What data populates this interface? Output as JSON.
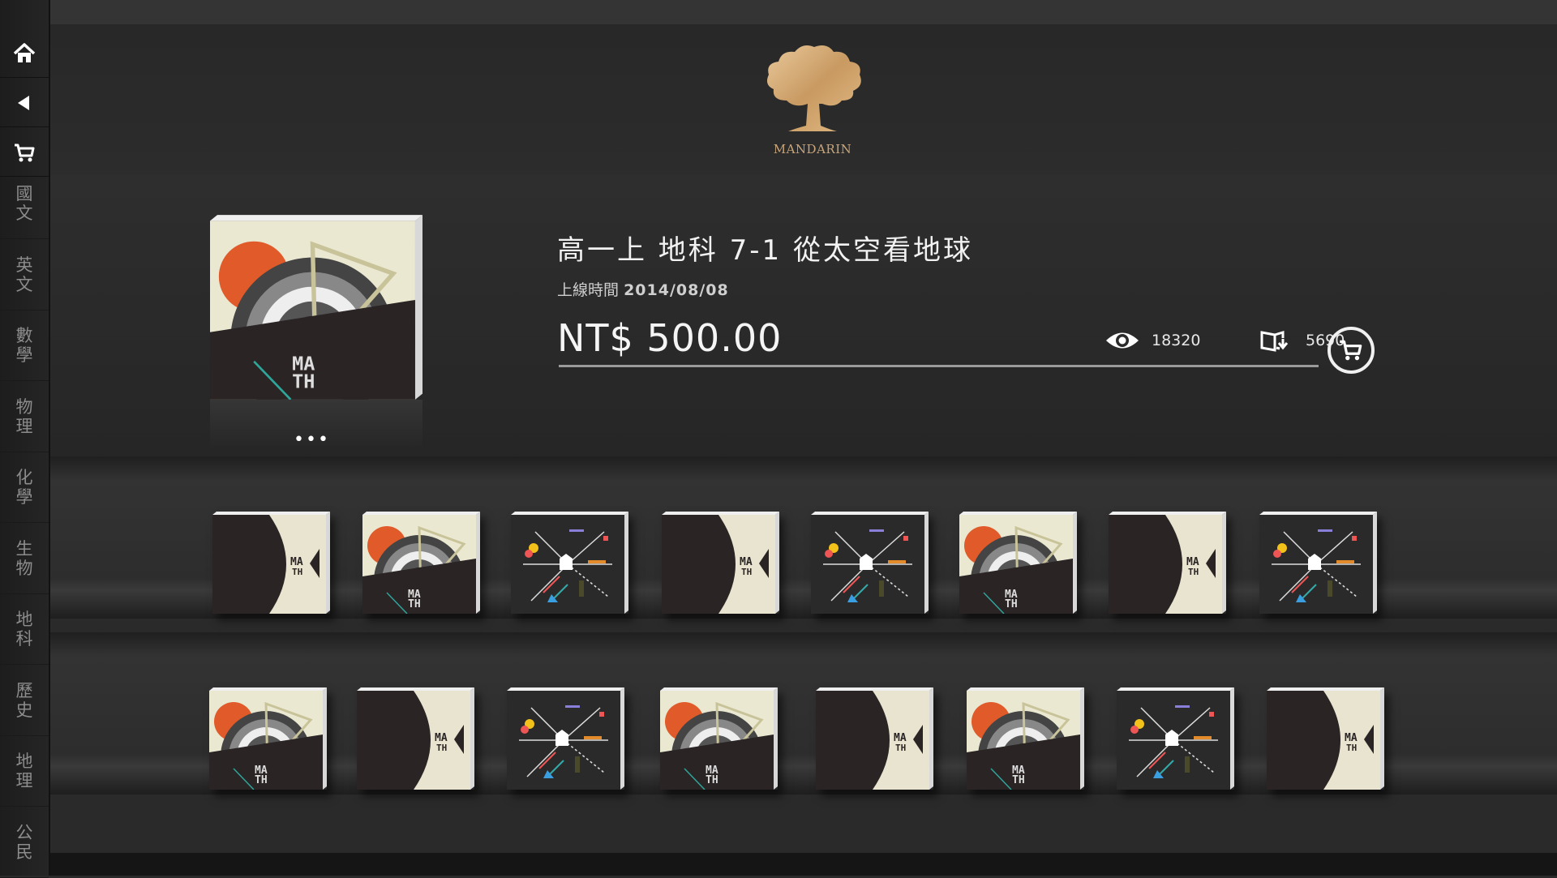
{
  "sidebar": {
    "nav": [
      {
        "icon": "home-icon"
      },
      {
        "icon": "back-icon"
      },
      {
        "icon": "cart-icon"
      }
    ],
    "subjects": [
      {
        "label": "國文"
      },
      {
        "label": "英文"
      },
      {
        "label": "數學"
      },
      {
        "label": "物理"
      },
      {
        "label": "化學"
      },
      {
        "label": "生物"
      },
      {
        "label": "地科"
      },
      {
        "label": "歷史"
      },
      {
        "label": "地理"
      },
      {
        "label": "公民"
      }
    ]
  },
  "header": {
    "logo_text": "MANDARIN",
    "logo_color": "#c8a579"
  },
  "detail": {
    "title": "高一上 地科 7-1 從太空看地球",
    "release_label": "上線時間",
    "release_date": "2014/08/08",
    "price": "NT$ 500.00",
    "views": "18320",
    "downloads": "5690",
    "dots": "•••"
  },
  "shelves": [
    {
      "books": [
        {
          "cover": "half-moon"
        },
        {
          "cover": "sunburst"
        },
        {
          "cover": "abstract"
        },
        {
          "cover": "half-moon"
        },
        {
          "cover": "abstract"
        },
        {
          "cover": "sunburst"
        },
        {
          "cover": "half-moon"
        },
        {
          "cover": "abstract"
        }
      ]
    },
    {
      "books": [
        {
          "cover": "sunburst"
        },
        {
          "cover": "half-moon"
        },
        {
          "cover": "abstract"
        },
        {
          "cover": "sunburst"
        },
        {
          "cover": "half-moon"
        },
        {
          "cover": "sunburst"
        },
        {
          "cover": "abstract"
        },
        {
          "cover": "half-moon"
        }
      ]
    }
  ]
}
